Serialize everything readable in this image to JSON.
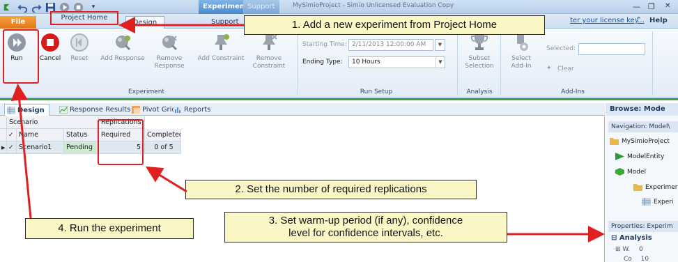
{
  "titlebar": {
    "context_tab": "Experiment Tools",
    "context_tab2": "Support",
    "window_title": "MySimioProject - Simio Unlicensed Evaluation Copy"
  },
  "tabs": {
    "file": "File",
    "project_home": "Project Home",
    "design": "Design",
    "support": "Support"
  },
  "license_link": "ter your license key...",
  "help": "Help",
  "ribbon": {
    "run": "Run",
    "cancel": "Cancel",
    "reset": "Reset",
    "add_response": "Add Response",
    "remove_response": "Remove Response",
    "add_constraint": "Add Constraint",
    "remove_constraint": "Remove Constraint",
    "group_experiment": "Experiment",
    "starting_time_label": "Starting Time:",
    "starting_time_value": "2/11/2013 12:00:00 AM",
    "ending_type_label": "Ending Type:",
    "ending_type_value": "10 Hours",
    "group_run_setup": "Run Setup",
    "subset_selection": "Subset Selection",
    "group_analysis": "Analysis",
    "select_addin": "Select Add-In",
    "selected_label": "Selected:",
    "clear": "Clear",
    "group_addins": "Add-Ins"
  },
  "doc_tabs": [
    "Design",
    "Response Results",
    "Pivot Grid",
    "Reports"
  ],
  "grid": {
    "header_scenario": "Scenario",
    "header_replications": "Replications",
    "col_name": "Name",
    "col_status": "Status",
    "col_required": "Required",
    "col_completed": "Completed",
    "row": {
      "name": "Scenario1",
      "status": "Pending",
      "required": "5",
      "completed": "0 of 5"
    }
  },
  "right_pane": {
    "browse_mode": "Browse: Mode",
    "navigation": "Navigation: Model\\",
    "nav_items": [
      "MySimioProject",
      "ModelEntity",
      "Model",
      "Experimer",
      "Experi"
    ],
    "properties": "Properties: Experim",
    "analysis": "Analysis",
    "w_label": "W.",
    "w_value": "0",
    "row2_label": "Co",
    "row2_value": "10"
  },
  "callouts": {
    "step1": "1. Add a new experiment from Project Home",
    "step2": "2. Set the number of required replications",
    "step3_line1": "3. Set warm-up period (if any), confidence",
    "step3_line2": "level for confidence intervals, etc.",
    "step4": "4. Run the experiment"
  },
  "colors": {
    "annotation_red": "#e02020",
    "callout_fill": "#fbf6c6",
    "ribbon_accent": "#3aa335",
    "pending_fill": "#cfe9d2"
  }
}
